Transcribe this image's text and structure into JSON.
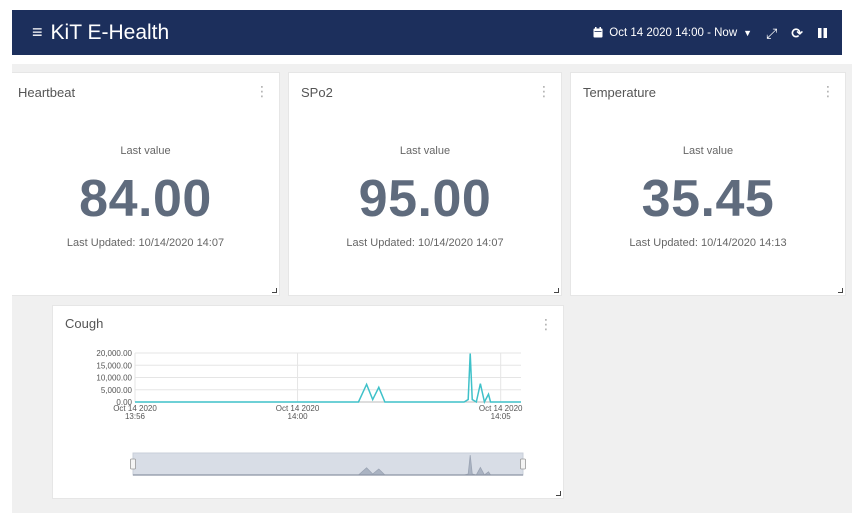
{
  "app": {
    "title": "KiT E-Health"
  },
  "toolbar": {
    "time_range": "Oct 14 2020 14:00 - Now",
    "icons": [
      "calendar-icon",
      "caret-down-icon",
      "expand-icon",
      "refresh-icon",
      "pause-icon"
    ]
  },
  "cards": {
    "heartbeat": {
      "title": "Heartbeat",
      "caption": "Last value",
      "value": "84.00",
      "updated": "Last Updated: 10/14/2020 14:07"
    },
    "spo2": {
      "title": "SPo2",
      "caption": "Last value",
      "value": "95.00",
      "updated": "Last Updated: 10/14/2020 14:07"
    },
    "temperature": {
      "title": "Temperature",
      "caption": "Last value",
      "value": "35.45",
      "updated": "Last Updated: 10/14/2020 14:13"
    }
  },
  "cough": {
    "title": "Cough"
  },
  "colors": {
    "header": "#1c2f5c",
    "line": "#3fc1c9",
    "value_text": "#5f6b7d",
    "navigator": "#d8dde6"
  },
  "chart_data": {
    "type": "line",
    "title": "Cough",
    "y_ticks": [
      "20,000.00",
      "15,000.00",
      "10,000.00",
      "5,000.00",
      "0.00"
    ],
    "ylim": [
      0,
      20000
    ],
    "x_tick_labels": [
      [
        "Oct 14 2020",
        "13:56"
      ],
      [
        "Oct 14 2020",
        "14:00"
      ],
      [
        "Oct 14 2020",
        "14:05"
      ]
    ],
    "x_ticks_minutes": [
      -4,
      0,
      5
    ],
    "xlim_minutes": [
      -4,
      5.5
    ],
    "grid": true,
    "series": [
      {
        "x_minutes": [
          -4.0,
          1.5,
          1.7,
          1.85,
          2.0,
          2.15,
          2.3,
          4.1,
          4.2,
          4.25,
          4.3,
          4.4,
          4.5,
          4.6,
          4.7,
          4.75,
          4.8,
          5.5
        ],
        "values": [
          0,
          0,
          7200,
          1000,
          6000,
          0,
          0,
          0,
          1000,
          19800,
          1000,
          0,
          7500,
          0,
          3200,
          0,
          0,
          0
        ]
      }
    ]
  }
}
